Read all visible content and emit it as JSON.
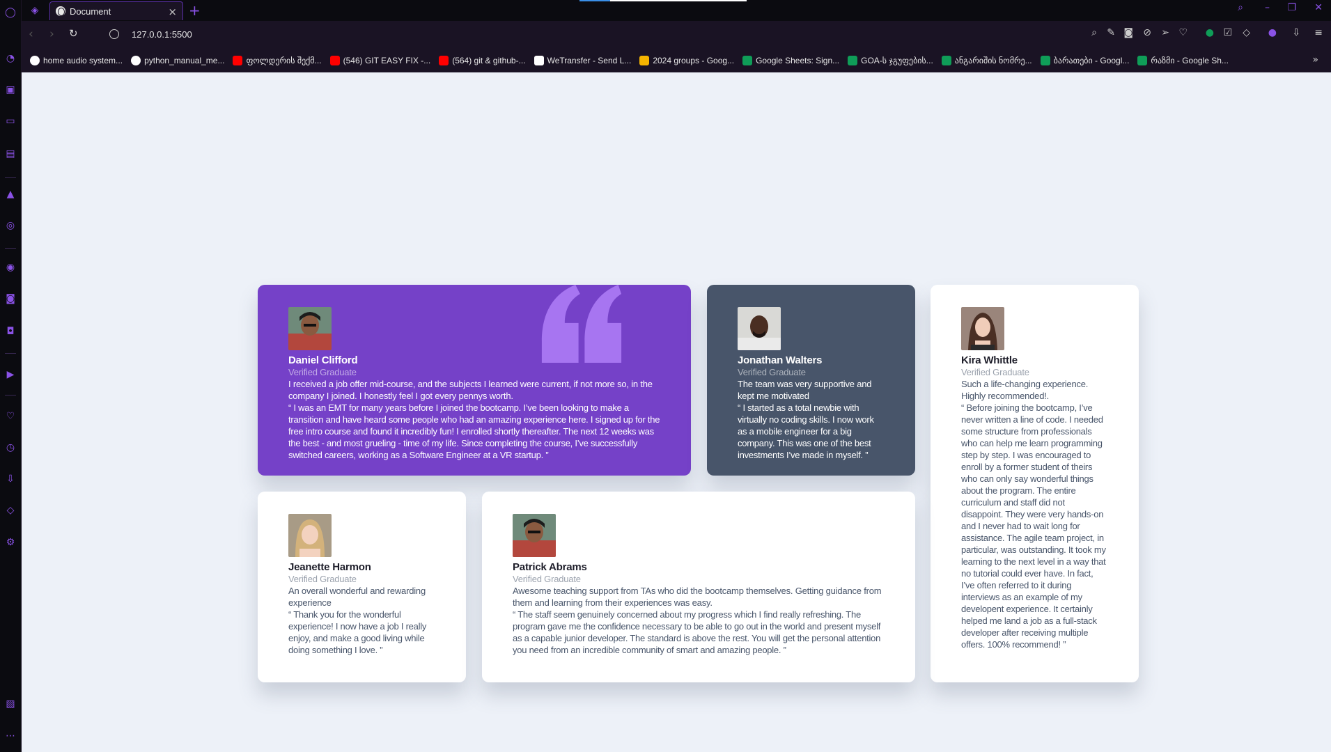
{
  "browser": {
    "tab": {
      "title": "Document"
    },
    "address": {
      "url": "127.0.0.1:5500"
    },
    "bookmarks": [
      {
        "label": "home audio system...",
        "color": "#ffffff"
      },
      {
        "label": "python_manual_me...",
        "color": "#ffffff"
      },
      {
        "label": "ფოლდერის შექმ...",
        "color": "#ff0000"
      },
      {
        "label": "(546) GIT EASY FIX -...",
        "color": "#ff0000"
      },
      {
        "label": "(564) git & github-...",
        "color": "#ff0000"
      },
      {
        "label": "WeTransfer - Send L...",
        "color": "#ffffff"
      },
      {
        "label": "2024 groups - Goog...",
        "color": "#f4b400"
      },
      {
        "label": "Google Sheets: Sign...",
        "color": "#0f9d58"
      },
      {
        "label": "GOA-ს ჯგუფების...",
        "color": "#0f9d58"
      },
      {
        "label": "ანგარიშის ნომრე...",
        "color": "#0f9d58"
      },
      {
        "label": "ბარათები - Googl...",
        "color": "#0f9d58"
      },
      {
        "label": "რაზმი - Google Sh...",
        "color": "#0f9d58"
      }
    ]
  },
  "testimonials": {
    "daniel": {
      "name": "Daniel Clifford",
      "role": "Verified Graduate",
      "headline": "I received a job offer mid-course, and the subjects I learned were current, if not more so, in the company I joined. I honestly feel I got every pennys worth.",
      "quote": "“ I was an EMT for many years before I joined the bootcamp. I’ve been looking to make a transition and have heard some people who had an amazing experience here. I signed up for the free intro course and found it incredibly fun! I enrolled shortly thereafter. The next 12 weeks was the best - and most grueling - time of my life. Since completing the course, I’ve successfully switched careers, working as a Software Engineer at a VR startup. ”"
    },
    "jonathan": {
      "name": "Jonathan Walters",
      "role": "Verified Graduate",
      "headline": "The team was very supportive and kept me motivated",
      "quote": "“ I started as a total newbie with virtually no coding skills. I now work as a mobile engineer for a big company. This was one of the best investments I’ve made in myself. ”"
    },
    "kira": {
      "name": "Kira Whittle",
      "role": "Verified Graduate",
      "headline": "Such a life-changing experience. Highly recommended!.",
      "quote": "“ Before joining the bootcamp, I’ve never written a line of code. I needed some structure from professionals who can help me learn programming step by step. I was encouraged to enroll by a former student of theirs who can only say wonderful things about the program. The entire curriculum and staff did not disappoint. They were very hands-on and I never had to wait long for assistance. The agile team project, in particular, was outstanding. It took my learning to the next level in a way that no tutorial could ever have. In fact, I’ve often referred to it during interviews as an example of my developent experience. It certainly helped me land a job as a full-stack developer after receiving multiple offers. 100% recommend! ”"
    },
    "jeanette": {
      "name": "Jeanette Harmon",
      "role": "Verified Graduate",
      "headline": "An overall wonderful and rewarding experience",
      "quote": "“ Thank you for the wonderful experience! I now have a job I really enjoy, and make a good living while doing something I love. ”"
    },
    "patrick": {
      "name": "Patrick Abrams",
      "role": "Verified Graduate",
      "headline": "Awesome teaching support from TAs who did the bootcamp themselves. Getting guidance from them and learning from their experiences was easy.",
      "quote": "“ The staff seem genuinely concerned about my progress which I find really refreshing. The program gave me the confidence necessary to be able to go out in the world and present myself as a capable junior developer. The standard is above the rest. You will get the personal attention you need from an incredible community of smart and amazing people. ”"
    }
  },
  "colors": {
    "purple": "#7541c8",
    "slate": "#48556a",
    "page_bg": "#edf1f8",
    "accent": "#8a52e6"
  }
}
